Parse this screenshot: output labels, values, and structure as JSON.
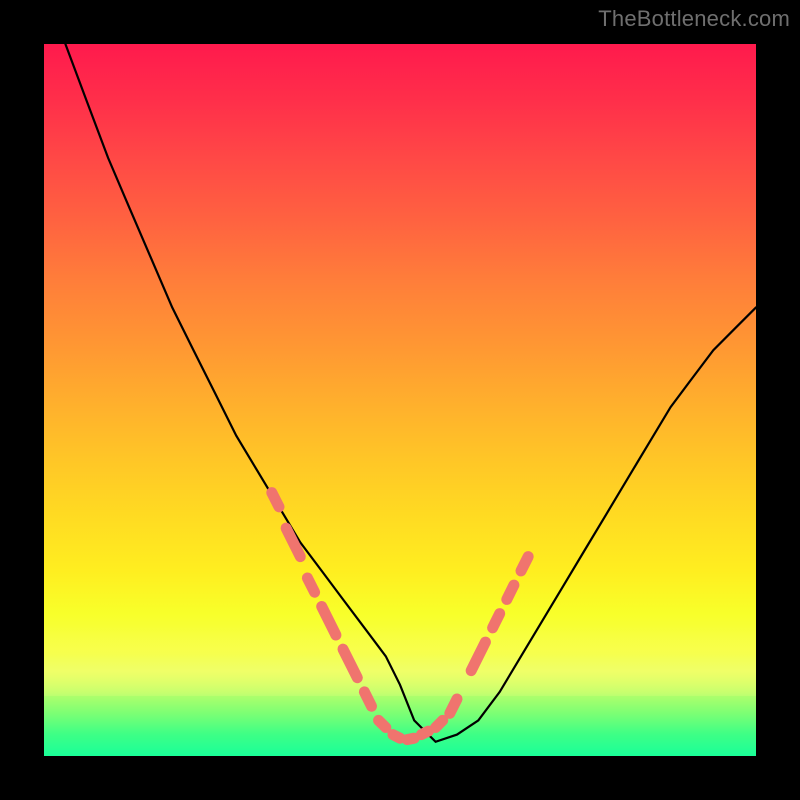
{
  "watermark": "TheBottleneck.com",
  "chart_data": {
    "type": "line",
    "title": "",
    "xlabel": "",
    "ylabel": "",
    "xlim": [
      0,
      100
    ],
    "ylim": [
      0,
      100
    ],
    "grid": false,
    "legend": false,
    "series": [
      {
        "name": "bottleneck-curve",
        "color": "#000000",
        "x": [
          3,
          6,
          9,
          12,
          15,
          18,
          21,
          24,
          27,
          30,
          33,
          36,
          39,
          42,
          45,
          48,
          50,
          52,
          55,
          58,
          61,
          64,
          67,
          70,
          73,
          76,
          79,
          82,
          85,
          88,
          91,
          94,
          97,
          100
        ],
        "y": [
          100,
          92,
          84,
          77,
          70,
          63,
          57,
          51,
          45,
          40,
          35,
          30,
          26,
          22,
          18,
          14,
          10,
          5,
          2,
          3,
          5,
          9,
          14,
          19,
          24,
          29,
          34,
          39,
          44,
          49,
          53,
          57,
          60,
          63
        ]
      }
    ],
    "markers": {
      "name": "dash-overlay",
      "color": "#f0746e",
      "segments": [
        {
          "x1": 32,
          "y1": 37,
          "x2": 33,
          "y2": 35
        },
        {
          "x1": 34,
          "y1": 32,
          "x2": 36,
          "y2": 28
        },
        {
          "x1": 37,
          "y1": 25,
          "x2": 38,
          "y2": 23
        },
        {
          "x1": 39,
          "y1": 21,
          "x2": 41,
          "y2": 17
        },
        {
          "x1": 42,
          "y1": 15,
          "x2": 44,
          "y2": 11
        },
        {
          "x1": 45,
          "y1": 9,
          "x2": 46,
          "y2": 7
        },
        {
          "x1": 47,
          "y1": 5,
          "x2": 48,
          "y2": 4
        },
        {
          "x1": 49,
          "y1": 3,
          "x2": 50,
          "y2": 2.5
        },
        {
          "x1": 51,
          "y1": 2.3,
          "x2": 52,
          "y2": 2.5
        },
        {
          "x1": 53,
          "y1": 3,
          "x2": 54,
          "y2": 3.5
        },
        {
          "x1": 55,
          "y1": 4,
          "x2": 56,
          "y2": 5
        },
        {
          "x1": 57,
          "y1": 6,
          "x2": 58,
          "y2": 8
        },
        {
          "x1": 60,
          "y1": 12,
          "x2": 62,
          "y2": 16
        },
        {
          "x1": 63,
          "y1": 18,
          "x2": 64,
          "y2": 20
        },
        {
          "x1": 65,
          "y1": 22,
          "x2": 66,
          "y2": 24
        },
        {
          "x1": 67,
          "y1": 26,
          "x2": 68,
          "y2": 28
        }
      ]
    },
    "background": {
      "type": "vertical-gradient",
      "stops": [
        {
          "pos": 0,
          "color": "#ff1a4d"
        },
        {
          "pos": 50,
          "color": "#ffae2d"
        },
        {
          "pos": 80,
          "color": "#f8ff2a"
        },
        {
          "pos": 100,
          "color": "#1eff93"
        }
      ]
    }
  }
}
